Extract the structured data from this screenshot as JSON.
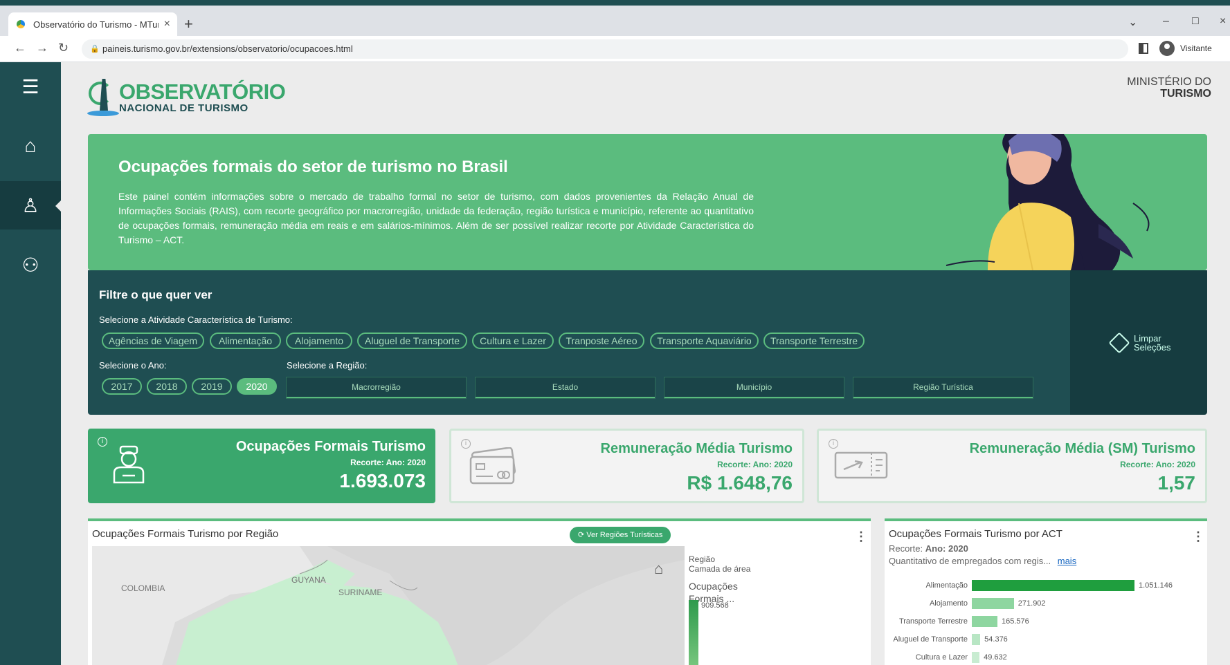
{
  "browser": {
    "tab_title": "Observatório do Turismo - MTur",
    "tab_close": "×",
    "new_tab": "+",
    "url": "paineis.turismo.gov.br/extensions/observatorio/ocupacoes.html",
    "profile_label": "Visitante",
    "win_min": "–",
    "win_max": "□",
    "win_close": "×",
    "win_chevron": "⌄",
    "back": "←",
    "forward": "→",
    "reload": "↻"
  },
  "sidebar": {
    "items": [
      {
        "icon": "menu-icon",
        "glyph": "☰"
      },
      {
        "icon": "home-icon",
        "glyph": "⌂"
      },
      {
        "icon": "worker-icon",
        "glyph": "♙"
      },
      {
        "icon": "group-icon",
        "glyph": "⚇"
      }
    ]
  },
  "header": {
    "logo_line1": "OBSERVATÓRIO",
    "logo_line2": "NACIONAL  DE  TURISMO",
    "ministry_line1": "MINISTÉRIO DO",
    "ministry_line2": "TURISMO"
  },
  "hero": {
    "title": "Ocupações formais do setor de turismo no Brasil",
    "description": "Este painel contém informações sobre o mercado de trabalho formal no setor de turismo, com dados provenientes da Relação Anual de Informações Sociais (RAIS), com recorte geográfico por macrorregião, unidade da federação, região turística e município, referente ao quantitativo de ocupações formais, remuneração média em reais e em salários-mínimos. Além de ser possível realizar recorte por Atividade Característica do Turismo – ACT."
  },
  "filters": {
    "title": "Filtre o que quer ver",
    "act_label": "Selecione a Atividade Característica de Turismo:",
    "act_options": [
      "Agências de Viagem",
      "Alimentação",
      "Alojamento",
      "Aluguel de Transporte",
      "Cultura e Lazer",
      "Tranposte Aéreo",
      "Transporte Aquaviário",
      "Transporte Terrestre"
    ],
    "year_label": "Selecione o Ano:",
    "years": [
      "2017",
      "2018",
      "2019",
      "2020"
    ],
    "selected_year": "2020",
    "region_label": "Selecione a Região:",
    "regions": [
      "Macrorregião",
      "Estado",
      "Município",
      "Região Turística"
    ],
    "clear_line1": "Limpar",
    "clear_line2": "Seleções"
  },
  "kpis": [
    {
      "title": "Ocupações Formais Turismo",
      "subtitle": "Recorte: Ano: 2020",
      "value": "1.693.073",
      "info": "i"
    },
    {
      "title": "Remuneração Média Turismo",
      "subtitle": "Recorte: Ano: 2020",
      "value": "R$ 1.648,76",
      "info": "i"
    },
    {
      "title": "Remuneração Média (SM) Turismo",
      "subtitle": "Recorte: Ano: 2020",
      "value": "1,57",
      "info": "i"
    }
  ],
  "map_card": {
    "title": "Ocupações Formais Turismo por Região",
    "button": "Ver Regiões Turísticas",
    "labels": [
      "COLOMBIA",
      "GUYANA",
      "SURINAME"
    ],
    "legend_region": "Região",
    "legend_layer": "Camada de área",
    "legend_measure_1": "Ocupações",
    "legend_measure_2": "Formais ...",
    "legend_max": "909.568",
    "home_glyph": "⌂",
    "kebab": "⋮"
  },
  "act_card": {
    "title": "Ocupações Formais Turismo por ACT",
    "recorte_label": "Recorte:",
    "recorte_value": "Ano: 2020",
    "desc": "Quantitativo de empregados com regis...",
    "more_link": "mais",
    "kebab": "⋮"
  },
  "chart_data": {
    "type": "bar",
    "orientation": "horizontal",
    "categories": [
      "Alimentação",
      "Alojamento",
      "Transporte Terrestre",
      "Aluguel de Transporte",
      "Cultura e Lazer"
    ],
    "values": [
      1051146,
      271902,
      165576,
      54376,
      49632
    ],
    "value_labels": [
      "1.051.146",
      "271.902",
      "165.576",
      "54.376",
      "49.632"
    ],
    "colors": [
      "#1f9e3e",
      "#8ed6a0",
      "#8ed6a0",
      "#b8e6c4",
      "#c8ecd1"
    ]
  },
  "colors": {
    "sidebar": "#1f4e52",
    "accent": "#5bbc7e",
    "kpi_green": "#3aa76d"
  }
}
